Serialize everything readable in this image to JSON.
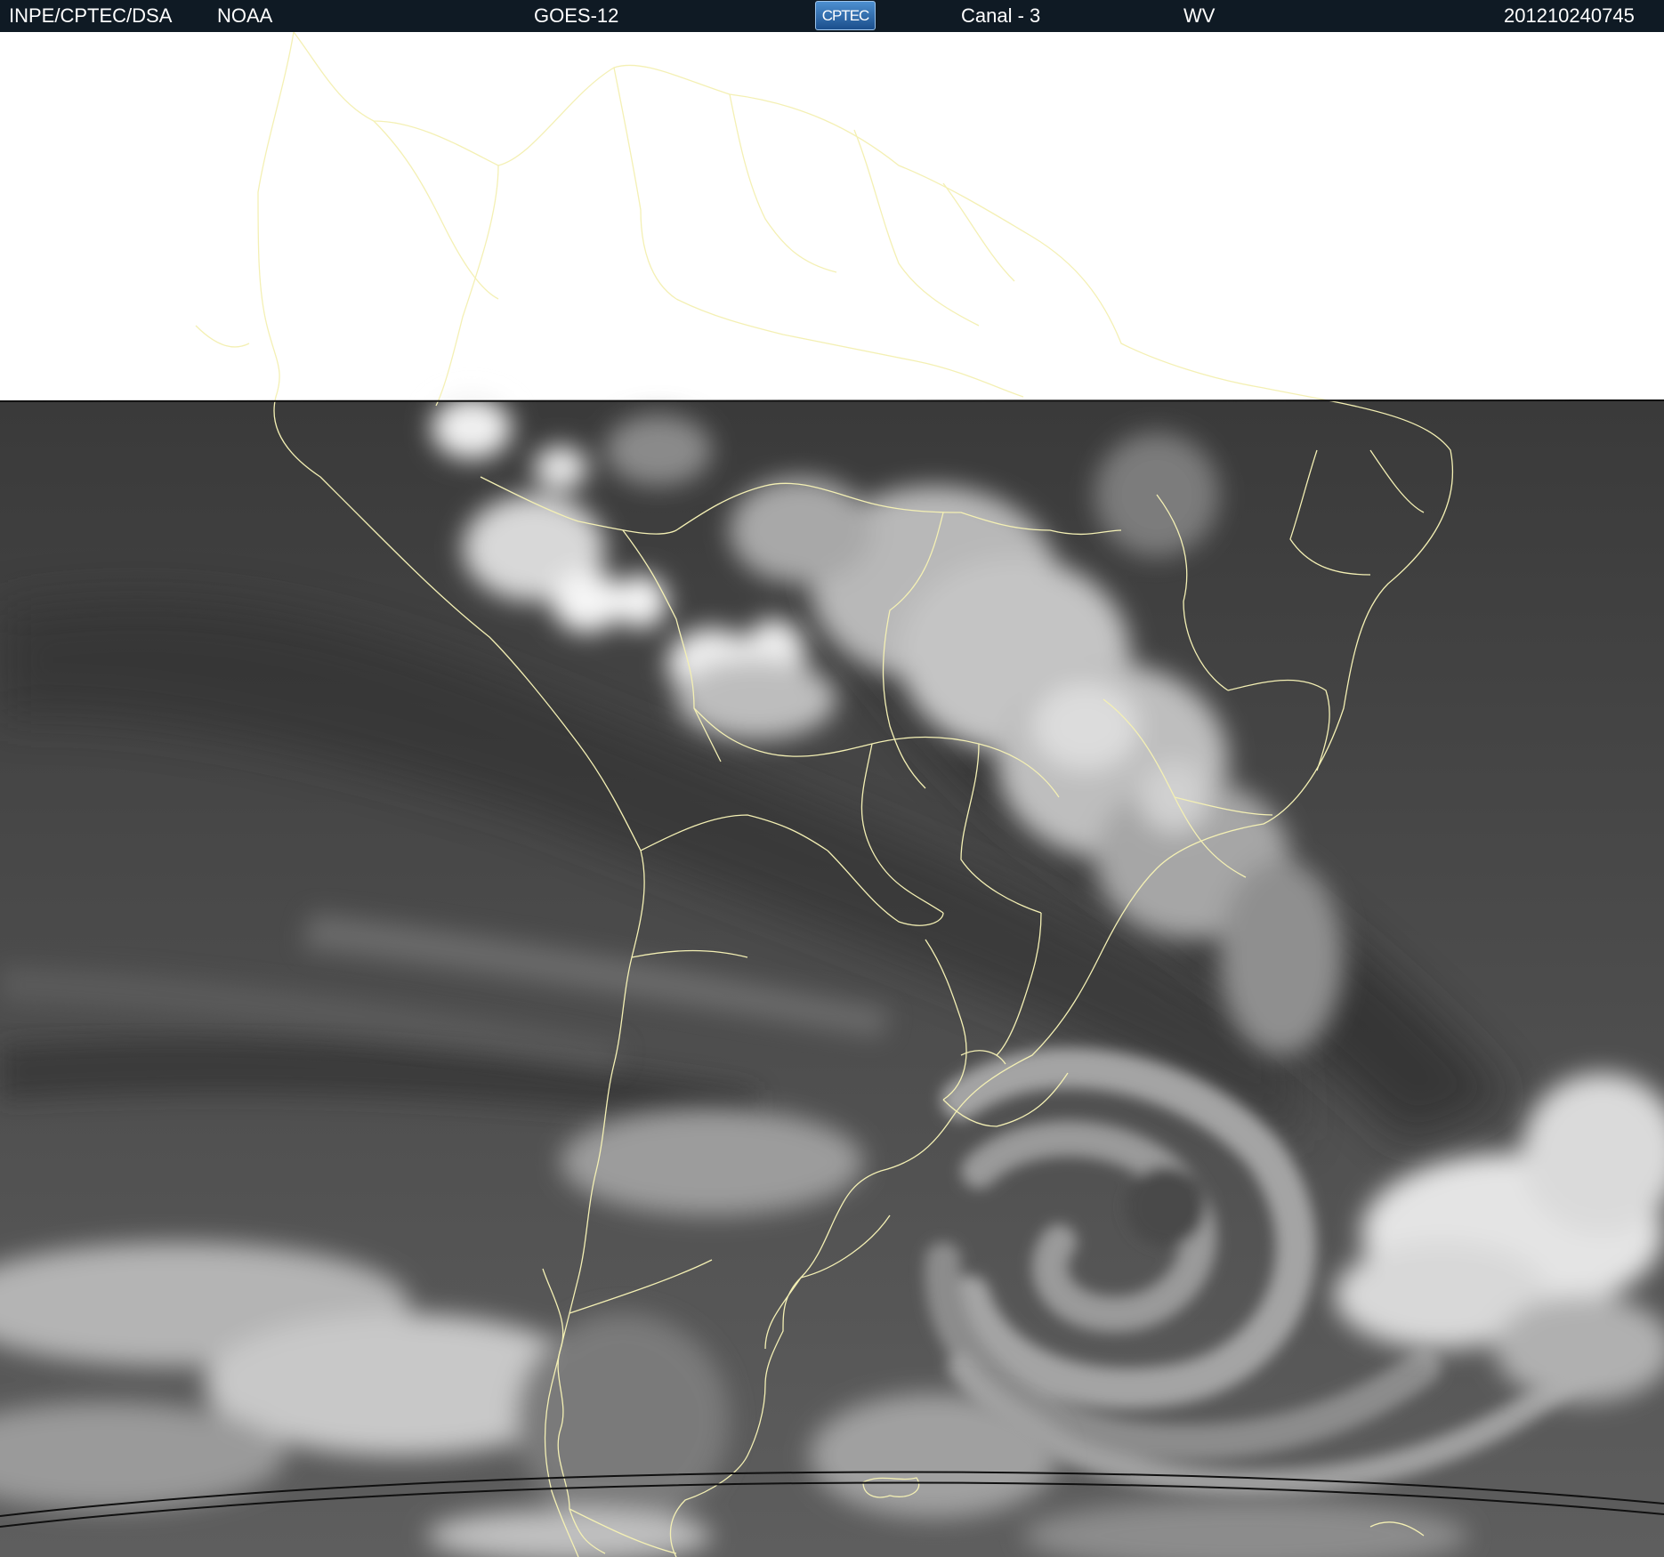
{
  "header": {
    "org": "INPE/CPTEC/DSA",
    "agency": "NOAA",
    "satellite": "GOES-12",
    "logo_text": "CPTEC",
    "channel": "Canal - 3",
    "band": "WV",
    "timestamp": "201210240745"
  },
  "image": {
    "description_icon": "satellite-water-vapor-image",
    "colors": {
      "background_top": "#ffffff",
      "map_lines": "#f4f0b4",
      "header_bg": "#0f1a24"
    }
  }
}
